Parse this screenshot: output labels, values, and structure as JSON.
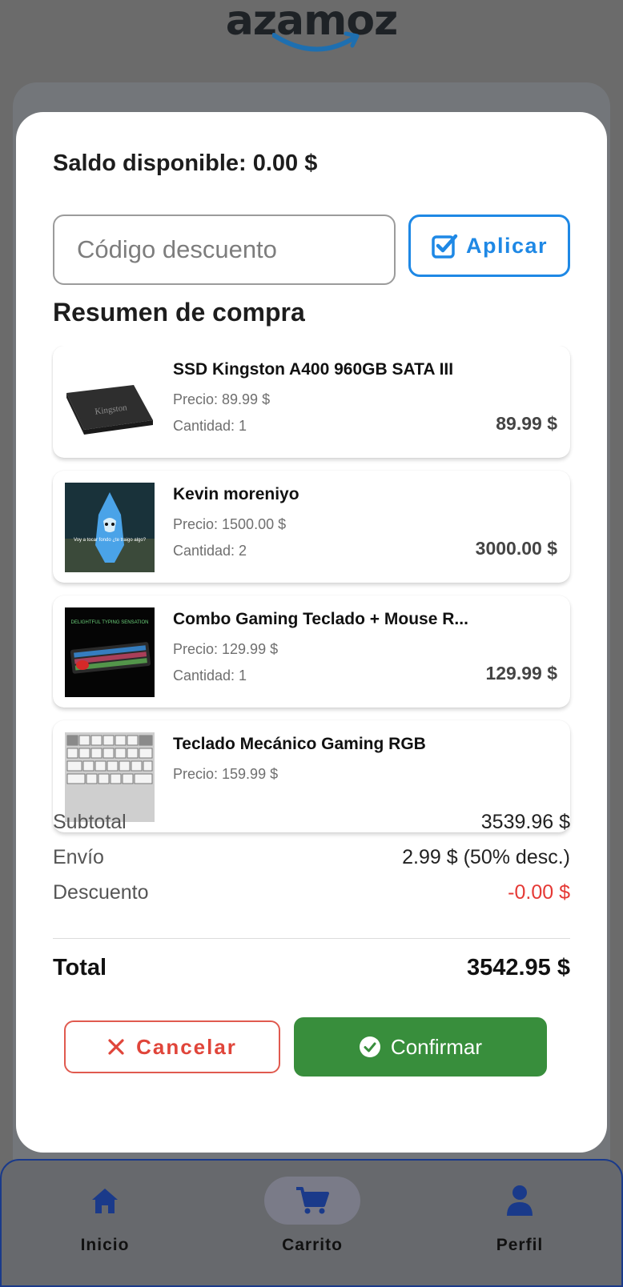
{
  "brand": {
    "logo_text": "azamoz"
  },
  "modal": {
    "balance_text": "Saldo disponible: 0.00 $",
    "discount": {
      "placeholder": "Código descuento",
      "value": ""
    },
    "apply_label": "Aplicar",
    "summary_title": "Resumen de compra",
    "items": [
      {
        "name": "SSD Kingston A400 960GB SATA III",
        "price": "Precio: 89.99 $",
        "qty": "Cantidad: 1",
        "total": "89.99 $",
        "thumb": "ssd-image",
        "thumb_text": "Kingston"
      },
      {
        "name": "Kevin moreniyo",
        "price": "Precio: 1500.00 $",
        "qty": "Cantidad: 2",
        "total": "3000.00 $",
        "thumb": "shark-costume-image",
        "thumb_text": "Voy a tocar fondo ¿te traigo algo?"
      },
      {
        "name": "Combo Gaming Teclado + Mouse R...",
        "price": "Precio: 129.99 $",
        "qty": "Cantidad: 1",
        "total": "129.99 $",
        "thumb": "keyboard-combo-image",
        "thumb_text": "DELIGHTFUL TYPING SENSATION"
      },
      {
        "name": "Teclado Mecánico Gaming RGB",
        "price": "Precio: 159.99 $",
        "qty": "",
        "total": "",
        "thumb": "mechanical-keyboard-image"
      }
    ],
    "totals": {
      "subtotal_label": "Subtotal",
      "subtotal_value": "3539.96 $",
      "shipping_label": "Envío",
      "shipping_value": "2.99 $ (50% desc.)",
      "discount_label": "Descuento",
      "discount_value": "-0.00 $",
      "total_label": "Total",
      "total_value": "3542.95 $"
    },
    "cancel_label": "Cancelar",
    "confirm_label": "Confirmar"
  },
  "nav": [
    {
      "label": "Inicio",
      "icon": "home-icon"
    },
    {
      "label": "Carrito",
      "icon": "cart-icon",
      "active": true
    },
    {
      "label": "Perfil",
      "icon": "person-icon"
    }
  ],
  "colors": {
    "accent": "#1e88e5",
    "confirm": "#388e3c",
    "cancel": "#e0453a",
    "nav_icon": "#1a3a8a"
  }
}
